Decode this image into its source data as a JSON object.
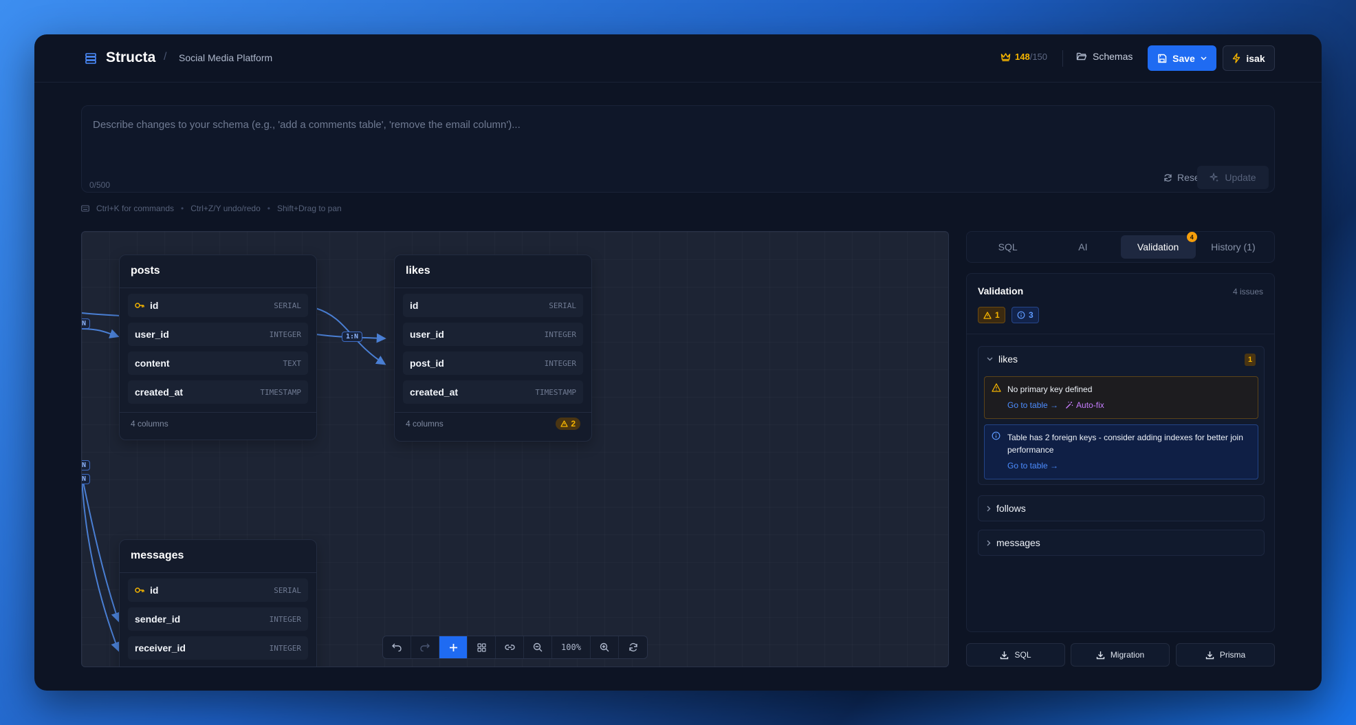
{
  "header": {
    "brand": "Structa",
    "separator": "/",
    "project": "Social Media Platform",
    "credits_used": "148",
    "credits_max": "/150",
    "schemas_label": "Schemas",
    "save_label": "Save",
    "user_name": "isak"
  },
  "prompt": {
    "placeholder": "Describe changes to your schema (e.g., 'add a comments table', 'remove the email column')...",
    "value": "",
    "char_count": "0/500",
    "reset_label": "Reset",
    "update_label": "Update"
  },
  "shortcuts": [
    "Ctrl+K for commands",
    "Ctrl+Z/Y undo/redo",
    "Shift+Drag to pan"
  ],
  "tables": [
    {
      "name": "posts",
      "columns": [
        {
          "name": "id",
          "type": "SERIAL",
          "pk": true
        },
        {
          "name": "user_id",
          "type": "INTEGER",
          "pk": false
        },
        {
          "name": "content",
          "type": "TEXT",
          "pk": false
        },
        {
          "name": "created_at",
          "type": "TIMESTAMP",
          "pk": false
        }
      ],
      "footer": "4 columns",
      "warnings": ""
    },
    {
      "name": "likes",
      "columns": [
        {
          "name": "id",
          "type": "SERIAL",
          "pk": false
        },
        {
          "name": "user_id",
          "type": "INTEGER",
          "pk": false
        },
        {
          "name": "post_id",
          "type": "INTEGER",
          "pk": false
        },
        {
          "name": "created_at",
          "type": "TIMESTAMP",
          "pk": false
        }
      ],
      "footer": "4 columns",
      "warnings": "2"
    },
    {
      "name": "messages",
      "columns": [
        {
          "name": "id",
          "type": "SERIAL",
          "pk": true
        },
        {
          "name": "sender_id",
          "type": "INTEGER",
          "pk": false
        },
        {
          "name": "receiver_id",
          "type": "INTEGER",
          "pk": false
        }
      ],
      "footer": "",
      "warnings": ""
    }
  ],
  "edge_labels": [
    "N",
    "1:N",
    "N",
    "N"
  ],
  "toolbar": {
    "zoom": "100%"
  },
  "tabs": [
    {
      "label": "SQL",
      "active": false,
      "badge": ""
    },
    {
      "label": "AI",
      "active": false,
      "badge": ""
    },
    {
      "label": "Validation",
      "active": true,
      "badge": "4"
    },
    {
      "label": "History (1)",
      "active": false,
      "badge": ""
    }
  ],
  "validation": {
    "title": "Validation",
    "issue_count": "4 issues",
    "warning_count": "1",
    "info_count": "3",
    "groups": [
      {
        "name": "likes",
        "badge": "1",
        "expanded": true,
        "issues": [
          {
            "severity": "warning",
            "text": "No primary key defined",
            "link": "Go to table →",
            "fix": "Auto-fix"
          },
          {
            "severity": "info",
            "text": "Table has 2 foreign keys - consider adding indexes for better join performance",
            "link": "Go to table →",
            "fix": ""
          }
        ]
      },
      {
        "name": "follows",
        "badge": "",
        "expanded": false,
        "issues": []
      },
      {
        "name": "messages",
        "badge": "",
        "expanded": false,
        "issues": []
      }
    ]
  },
  "exports": [
    "SQL",
    "Migration",
    "Prisma"
  ],
  "colors": {
    "accent": "#1f6bf2",
    "warning": "#f5b400",
    "info": "#4d8dff",
    "autofix": "#c77dff",
    "edge": "#4a7fd4"
  }
}
